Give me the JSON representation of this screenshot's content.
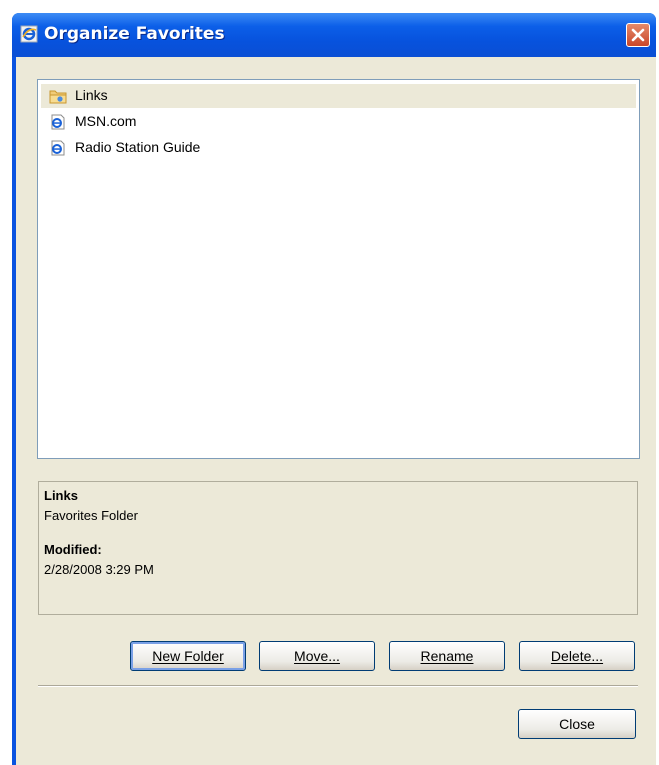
{
  "window": {
    "title": "Organize Favorites"
  },
  "favorites": {
    "items": [
      {
        "label": "Links",
        "icon": "folder-icon",
        "selected": true
      },
      {
        "label": "MSN.com",
        "icon": "ie-page-icon",
        "selected": false
      },
      {
        "label": "Radio Station Guide",
        "icon": "ie-page-icon",
        "selected": false
      }
    ]
  },
  "details": {
    "name": "Links",
    "type": "Favorites Folder",
    "modified_label": "Modified:",
    "modified_value": "2/28/2008 3:29 PM"
  },
  "buttons": {
    "new_folder": "New Folder",
    "move": "Move...",
    "rename": "Rename",
    "delete": "Delete...",
    "close": "Close"
  },
  "colors": {
    "titlebar": "#0752dd",
    "client": "#ece9d8",
    "close_button": "#c9462a"
  }
}
